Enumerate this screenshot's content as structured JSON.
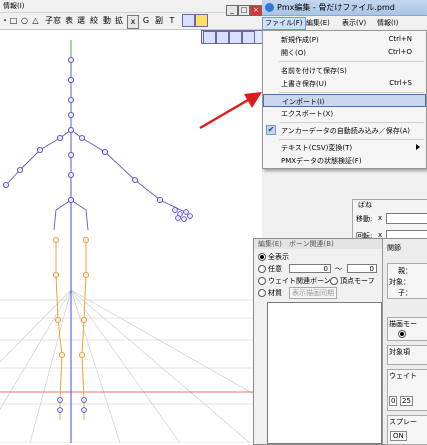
{
  "view": {
    "menu_label": "情報(I)",
    "toolbar": [
      "・",
      "□",
      "○",
      "△",
      "子窓",
      "表",
      "選",
      "絞",
      "動",
      "拡",
      "x",
      "G",
      "副",
      "T"
    ]
  },
  "editor": {
    "title": "Pmx編集 - 骨だけファイル.pmd",
    "menus": [
      "ファイル(F)",
      "編集(E)",
      "表示(V)",
      "情報(I)"
    ],
    "window_buttons": [
      "_",
      "□",
      "×"
    ],
    "panel": {
      "group_title": "ばね",
      "move_label": "移動:",
      "rotate_label": "回転:",
      "x_label": "x"
    }
  },
  "file_menu": {
    "items": [
      {
        "label": "新規作成(P)",
        "shortcut": "Ctrl+N"
      },
      {
        "label": "開く(O)",
        "shortcut": "Ctrl+O"
      },
      {
        "label": "名前を付けて保存(S)",
        "shortcut": ""
      },
      {
        "label": "上書き保存(U)",
        "shortcut": "Ctrl+S"
      },
      {
        "label": "インポート(I)",
        "shortcut": ""
      },
      {
        "label": "エクスポート(X)",
        "shortcut": ""
      },
      {
        "label": "アンカーデータの自動読み込み／保存(A)",
        "shortcut": ""
      },
      {
        "label": "テキスト(CSV)変換(T)",
        "shortcut": ""
      },
      {
        "label": "PMXデータの状態検証(F)",
        "shortcut": ""
      }
    ]
  },
  "bone_edit": {
    "header": "編集(E)　ボーン関連(B)",
    "show_all": "全表示",
    "any": "任意",
    "range_from": "0",
    "range_sep": "～",
    "range_to": "0",
    "weight_bone": "ウェイト関連ボーン",
    "vertex_morph": "頂点モーフ",
    "material": "材質",
    "draw_sync": "表示描画同期",
    "right_panel": {
      "tab": "関節",
      "parent": "親：",
      "target": "対象：",
      "child": "子：",
      "draw_mode": "描画モー",
      "target_label": "対象項",
      "weight": "ウェイト",
      "values": [
        "0",
        "25"
      ],
      "spray": "スプレー",
      "on": "ON"
    }
  },
  "colors": {
    "accent_arrow": "#e01a1a",
    "highlight": "#c8d7ec",
    "skeleton_blue": "#5b5bc8",
    "skeleton_orange": "#f0a030",
    "axis_green": "#3cb43c",
    "axis_red": "#e04040"
  }
}
